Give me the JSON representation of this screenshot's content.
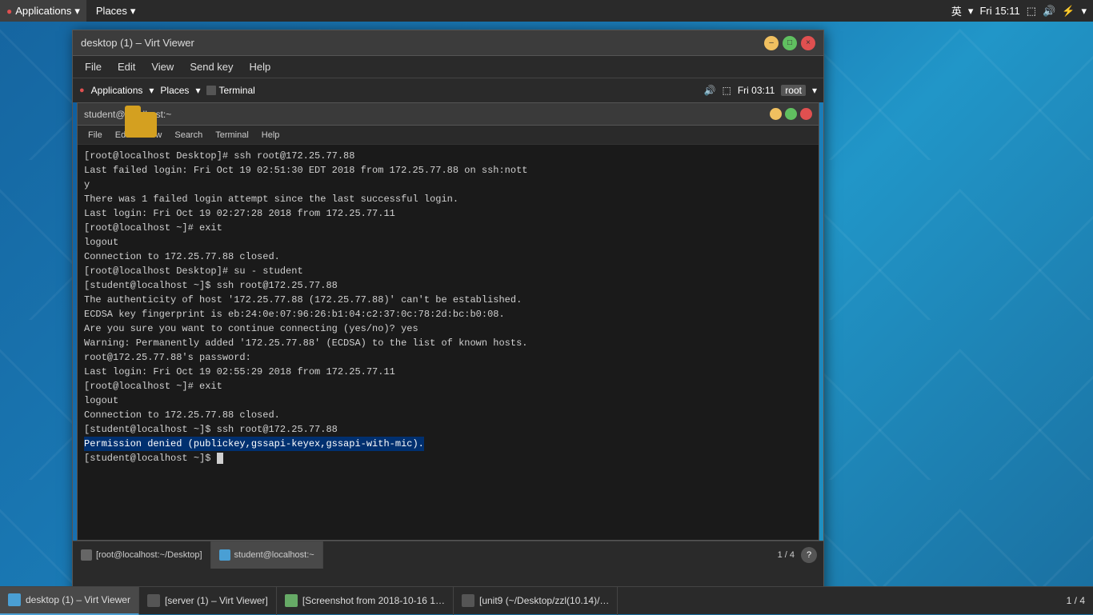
{
  "topbar": {
    "applications_label": "Applications",
    "places_label": "Places",
    "lang_label": "英",
    "time_label": "Fri 15:11"
  },
  "virt_window": {
    "title": "desktop (1) – Virt Viewer",
    "minimize_label": "–",
    "maximize_label": "□",
    "close_label": "×",
    "menu": {
      "file": "File",
      "edit": "Edit",
      "view": "View",
      "send_key": "Send key",
      "help": "Help"
    }
  },
  "inner_topbar": {
    "applications_label": "Applications",
    "places_label": "Places",
    "terminal_label": "Terminal",
    "time_label": "Fri 03:11",
    "user_label": "root"
  },
  "terminal_window": {
    "title": "student@localhost:~",
    "menu": {
      "file": "File",
      "edit": "Edit",
      "view": "View",
      "search": "Search",
      "terminal": "Terminal",
      "help": "Help"
    },
    "content_lines": [
      "[root@localhost Desktop]# ssh root@172.25.77.88",
      "Last failed login: Fri Oct 19 02:51:30 EDT 2018 from 172.25.77.88 on ssh:nott",
      "y",
      "There was 1 failed login attempt since the last successful login.",
      "Last login: Fri Oct 19 02:27:28 2018 from 172.25.77.11",
      "[root@localhost ~]# exit",
      "logout",
      "Connection to 172.25.77.88 closed.",
      "[root@localhost Desktop]# su - student",
      "[student@localhost ~]$ ssh root@172.25.77.88",
      "The authenticity of host '172.25.77.88 (172.25.77.88)' can't be established.",
      "ECDSA key fingerprint is eb:24:0e:07:96:26:b1:04:c2:37:0c:78:2d:bc:b0:08.",
      "Are you sure you want to continue connecting (yes/no)? yes",
      "Warning: Permanently added '172.25.77.88' (ECDSA) to the list of known hosts.",
      "root@172.25.77.88's password:",
      "Last login: Fri Oct 19 02:55:29 2018 from 172.25.77.11",
      "[root@localhost ~]# exit",
      "logout",
      "Connection to 172.25.77.88 closed.",
      "[student@localhost ~]$ ssh root@172.25.77.88",
      "Permission denied (publickey,gssapi-keyex,gssapi-with-mic).",
      "[student@localhost ~]$ "
    ],
    "highlighted_line": "Permission denied (publickey,gssapi-keyex,gssapi-with-mic)."
  },
  "vm_taskbar": {
    "task1_label": "[root@localhost:~/Desktop]",
    "task2_label": "student@localhost:~",
    "page_indicator": "1 / 4"
  },
  "main_taskbar": {
    "items": [
      {
        "label": "desktop (1) – Virt Viewer",
        "active": true
      },
      {
        "label": "[server (1) – Virt Viewer]",
        "active": false
      },
      {
        "label": "[Screenshot from 2018-10-16 1…",
        "active": false
      },
      {
        "label": "[unit9 (~/Desktop/zzl(10.14)/…",
        "active": false
      }
    ],
    "page_indicator": "1 / 4"
  }
}
